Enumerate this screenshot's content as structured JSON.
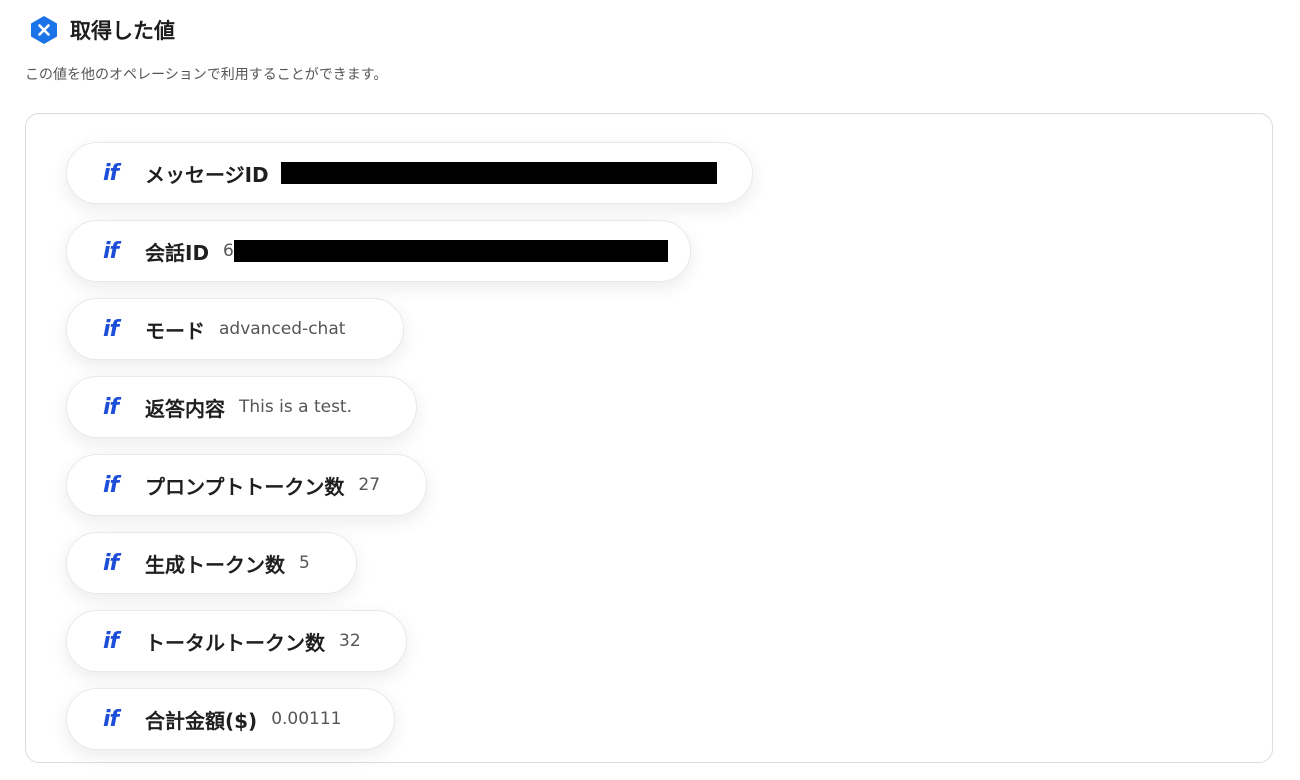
{
  "header": {
    "title": "取得した値",
    "description": "この値を他のオペレーションで利用することができます。"
  },
  "fields": [
    {
      "label": "メッセージID",
      "value": "",
      "redacted": true
    },
    {
      "label": "会話ID",
      "value": "6",
      "redacted": true
    },
    {
      "label": "モード",
      "value": "advanced-chat"
    },
    {
      "label": "返答内容",
      "value": "This is a test."
    },
    {
      "label": "プロンプトトークン数",
      "value": "27"
    },
    {
      "label": "生成トークン数",
      "value": "5"
    },
    {
      "label": "トータルトークン数",
      "value": "32"
    },
    {
      "label": "合計金額($)",
      "value": "0.00111"
    }
  ],
  "icons": {
    "header": "x-hexagon-icon",
    "field": "if-variable-icon"
  },
  "colors": {
    "accent": "#1d4ed8",
    "badge": "#1a73e8"
  }
}
